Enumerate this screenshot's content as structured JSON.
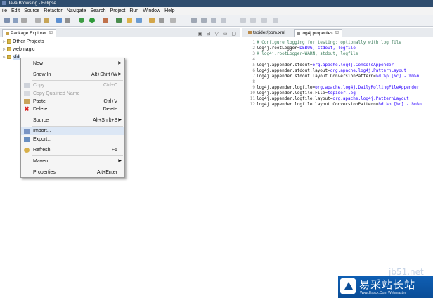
{
  "window": {
    "title": "Java Browsing - Eclipse"
  },
  "menubar": [
    "ile",
    "Edit",
    "Source",
    "Refactor",
    "Navigate",
    "Search",
    "Project",
    "Run",
    "Window",
    "Help"
  ],
  "package_explorer": {
    "title": "Package Explorer",
    "close": "☒",
    "tools": "▣ ⊟ ▽ ▭ ▢",
    "tree": [
      {
        "label": "Other Projects",
        "expanded": false
      },
      {
        "label": "webmagic",
        "expanded": false
      },
      {
        "label": "sfdi",
        "selected": true
      }
    ]
  },
  "context_menu": {
    "items": [
      {
        "label": "New",
        "shortcut": "",
        "submenu": true,
        "disabled": false,
        "icon": ""
      },
      {
        "label": "Show In",
        "shortcut": "Alt+Shift+W",
        "submenu": true,
        "disabled": false,
        "icon": ""
      },
      {
        "label": "Copy",
        "shortcut": "Ctrl+C",
        "submenu": false,
        "disabled": true,
        "icon": "copy-icon"
      },
      {
        "label": "Copy Qualified Name",
        "shortcut": "",
        "submenu": false,
        "disabled": true,
        "icon": "copy-qualified-icon"
      },
      {
        "label": "Paste",
        "shortcut": "Ctrl+V",
        "submenu": false,
        "disabled": false,
        "icon": "paste-icon"
      },
      {
        "label": "Delete",
        "shortcut": "Delete",
        "submenu": false,
        "disabled": false,
        "icon": "delete-icon"
      },
      {
        "label": "Source",
        "shortcut": "Alt+Shift+S",
        "submenu": true,
        "disabled": false,
        "icon": ""
      },
      {
        "label": "Import...",
        "shortcut": "",
        "submenu": false,
        "disabled": false,
        "icon": "import-icon",
        "highlighted": true
      },
      {
        "label": "Export...",
        "shortcut": "",
        "submenu": false,
        "disabled": false,
        "icon": "export-icon"
      },
      {
        "label": "Refresh",
        "shortcut": "F5",
        "submenu": false,
        "disabled": false,
        "icon": "refresh-icon"
      },
      {
        "label": "Maven",
        "shortcut": "",
        "submenu": true,
        "disabled": false,
        "icon": ""
      },
      {
        "label": "Properties",
        "shortcut": "Alt+Enter",
        "submenu": false,
        "disabled": false,
        "icon": ""
      }
    ]
  },
  "editor": {
    "tabs": [
      {
        "label": "tspider/pom.xml",
        "active": false
      },
      {
        "label": "log4j.properties",
        "active": true,
        "close": "☒"
      }
    ],
    "lines": [
      {
        "n": "1",
        "text": "# Configure logging for testing: optionally with log file",
        "comment": true
      },
      {
        "n": "2",
        "key": "log4j.rootLogger=",
        "val": "DEBUG, stdout, logfile"
      },
      {
        "n": "3",
        "text": "# log4j.rootLogger=WARN, stdout, logfile",
        "comment": true
      },
      {
        "n": "4",
        "key": "",
        "val": ""
      },
      {
        "n": "5",
        "key": "log4j.appender.stdout=",
        "val": "org.apache.log4j.ConsoleAppender"
      },
      {
        "n": "6",
        "key": "log4j.appender.stdout.layout=",
        "val": "org.apache.log4j.PatternLayout"
      },
      {
        "n": "7",
        "key": "log4j.appender.stdout.layout.ConversionPattern=",
        "val": "%d %p [%c] - %m%n"
      },
      {
        "n": "8",
        "key": "",
        "val": ""
      },
      {
        "n": "9",
        "key": "log4j.appender.logfile=",
        "val": "org.apache.log4j.DailyRollingFileAppender"
      },
      {
        "n": "10",
        "key": "log4j.appender.logfile.File=",
        "val": "tspider.log"
      },
      {
        "n": "11",
        "key": "log4j.appender.logfile.layout=",
        "val": "org.apache.log4j.PatternLayout"
      },
      {
        "n": "12",
        "key": "log4j.appender.logfile.layout.ConversionPattern=",
        "val": "%d %p [%c] - %m%n"
      }
    ]
  },
  "watermark": {
    "faint": "jb51.net",
    "cn": "易采站长站",
    "en": "Www.Easck.Com Webmaster"
  },
  "colors": {
    "comment": "#3f7f5f",
    "value": "#2a00ff",
    "titlebar": "#2f4d6e",
    "menu_highlight": "#dce7f5"
  }
}
